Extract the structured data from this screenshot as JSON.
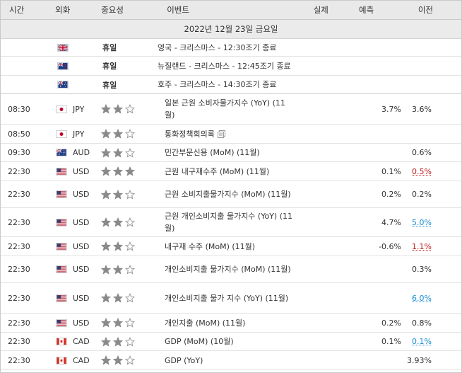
{
  "header": {
    "time": "시간",
    "currency": "외화",
    "importance": "중요성",
    "event": "이벤트",
    "actual": "실제",
    "forecast": "예측",
    "previous": "이전"
  },
  "date_label": "2022년 12월 23일 금요일",
  "holidays": [
    {
      "flag": "uk",
      "label": "휴일",
      "event": "영국 - 크리스마스 - 12:30조기 종료"
    },
    {
      "flag": "nz",
      "label": "휴일",
      "event": "뉴질랜드 - 크리스마스 - 12:45조기 종료"
    },
    {
      "flag": "au",
      "label": "휴일",
      "event": "호주 - 크리스마스 - 14:30조기 종료"
    }
  ],
  "events": [
    {
      "time": "08:30",
      "flag": "jp",
      "currency": "JPY",
      "stars": 2,
      "event": "일본 근원 소비자물가지수 (YoY) (11월)",
      "actual": "",
      "forecast": "3.7%",
      "previous": "3.6%",
      "prev_color": ""
    },
    {
      "time": "08:50",
      "flag": "jp",
      "currency": "JPY",
      "stars": 2,
      "event": "통화정책회의록",
      "actual": "",
      "forecast": "",
      "previous": "",
      "prev_color": "",
      "doc_icon": "document-icon"
    },
    {
      "time": "09:30",
      "flag": "au",
      "currency": "AUD",
      "stars": 2,
      "event": "민간부문신용 (MoM) (11월)",
      "actual": "",
      "forecast": "",
      "previous": "0.6%",
      "prev_color": ""
    },
    {
      "time": "22:30",
      "flag": "us",
      "currency": "USD",
      "stars": 3,
      "event": "근원 내구재수주 (MoM) (11월)",
      "actual": "",
      "forecast": "0.1%",
      "previous": "0.5%",
      "prev_color": "red"
    },
    {
      "time": "22:30",
      "flag": "us",
      "currency": "USD",
      "stars": 2,
      "event": "근원 소비지출물가지수 (MoM) (11월)",
      "actual": "",
      "forecast": "0.2%",
      "previous": "0.2%",
      "prev_color": ""
    },
    {
      "time": "22:30",
      "flag": "us",
      "currency": "USD",
      "stars": 2,
      "event": "근원 개인소비지출 물가지수 (YoY) (11월)",
      "actual": "",
      "forecast": "4.7%",
      "previous": "5.0%",
      "prev_color": "blue"
    },
    {
      "time": "22:30",
      "flag": "us",
      "currency": "USD",
      "stars": 2,
      "event": "내구재 수주 (MoM) (11월)",
      "actual": "",
      "forecast": "-0.6%",
      "previous": "1.1%",
      "prev_color": "red"
    },
    {
      "time": "22:30",
      "flag": "us",
      "currency": "USD",
      "stars": 2,
      "event": "개인소비지출 물가지수 (MoM) (11월)",
      "actual": "",
      "forecast": "",
      "previous": "0.3%",
      "prev_color": ""
    },
    {
      "time": "22:30",
      "flag": "us",
      "currency": "USD",
      "stars": 2,
      "event": "개인소비지출 물가 지수 (YoY) (11월)",
      "actual": "",
      "forecast": "",
      "previous": "6.0%",
      "prev_color": "blue"
    },
    {
      "time": "22:30",
      "flag": "us",
      "currency": "USD",
      "stars": 2,
      "event": "개인지출 (MoM) (11월)",
      "actual": "",
      "forecast": "0.2%",
      "previous": "0.8%",
      "prev_color": ""
    },
    {
      "time": "22:30",
      "flag": "ca",
      "currency": "CAD",
      "stars": 2,
      "event": "GDP (MoM) (10월)",
      "actual": "",
      "forecast": "0.1%",
      "previous": "0.1%",
      "prev_color": "blue"
    },
    {
      "time": "22:30",
      "flag": "ca",
      "currency": "CAD",
      "stars": 2,
      "event": "GDP (YoY)",
      "actual": "",
      "forecast": "",
      "previous": "3.93%",
      "prev_color": ""
    }
  ],
  "colors": {
    "header_bg": "#e9e9e9",
    "star": "#8a8a8a",
    "prev_red": "#c21d1d",
    "prev_blue": "#1a8fd6"
  }
}
